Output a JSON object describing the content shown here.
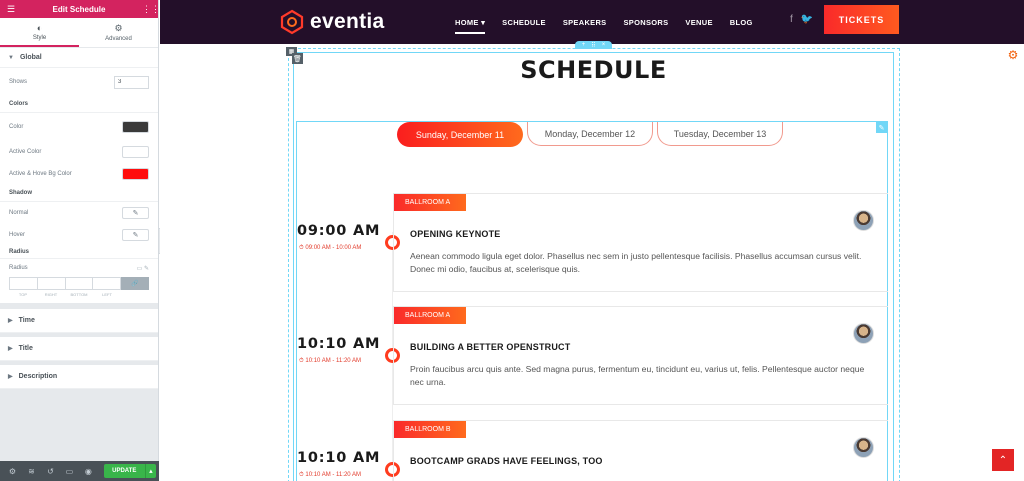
{
  "panel": {
    "header_title": "Edit Schedule",
    "tabs": [
      {
        "label": "Style",
        "icon": "half-circle-icon"
      },
      {
        "label": "Advanced",
        "icon": "gear-icon"
      }
    ],
    "global_section": "Global",
    "shows_label": "Shows",
    "shows_value": "3",
    "colors_heading": "Colors",
    "color_label": "Color",
    "color_value": "#3a3a3a",
    "active_color_label": "Active Color",
    "active_color_value": "#ffffff",
    "hover_bg_label": "Active & Hove Bg Color",
    "hover_bg_value": "#ff0d0d",
    "shadow_heading": "Shadow",
    "normal_label": "Normal",
    "hover_label": "Hover",
    "radius_heading": "Radius",
    "radius_label": "Radius",
    "dim_labels": [
      "TOP",
      "RIGHT",
      "BOTTOM",
      "LEFT"
    ],
    "time_section": "Time",
    "title_section": "Title",
    "description_section": "Description",
    "update_label": "UPDATE"
  },
  "site": {
    "logo_text": "eventia",
    "nav": [
      "HOME",
      "SCHEDULE",
      "SPEAKERS",
      "SPONSORS",
      "VENUE",
      "BLOG"
    ],
    "tickets_label": "TICKETS",
    "page_title": "SCHEDULE",
    "days": [
      "Sunday, December 11",
      "Monday, December 12",
      "Tuesday, December 13"
    ],
    "sessions": [
      {
        "time": "09:00 AM",
        "range": "09:00 AM - 10:00 AM",
        "room": "BALLROOM A",
        "title": "OPENING KEYNOTE",
        "desc": "Aenean commodo ligula eget dolor. Phasellus nec sem in justo pellentesque facilisis. Phasellus accumsan cursus velit. Donec mi odio, faucibus at, scelerisque quis."
      },
      {
        "time": "10:10 AM",
        "range": "10:10 AM - 11:20 AM",
        "room": "BALLROOM A",
        "title": "BUILDING A BETTER OPENSTRUCT",
        "desc": "Proin faucibus arcu quis ante. Sed magna purus, fermentum eu, tincidunt eu, varius ut, felis. Pellentesque auctor neque nec urna."
      },
      {
        "time": "10:10 AM",
        "range": "10:10 AM - 11:20 AM",
        "room": "BALLROOM B",
        "title": "BOOTCAMP GRADS HAVE FEELINGS, TOO",
        "desc": ""
      }
    ]
  },
  "colors": {
    "accent": "#d3235f",
    "brand_red": "#fa2a2a",
    "brand_orange": "#ff6a1d",
    "nav_bg": "#230f29",
    "editor_cyan": "#71d7f7"
  }
}
